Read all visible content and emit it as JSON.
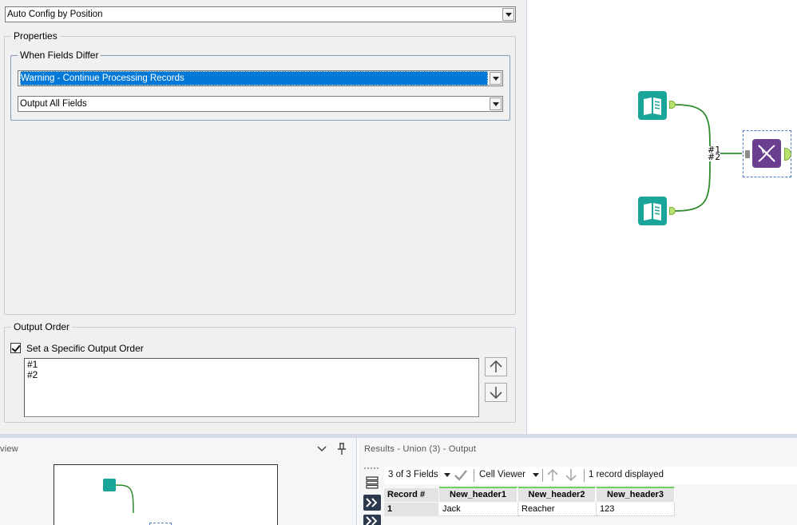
{
  "config": {
    "mode_select": "Auto Config by Position",
    "properties_legend": "Properties",
    "when_fields_differ_legend": "When Fields Differ",
    "action_select": "Warning - Continue Processing Records",
    "output_fields_select": "Output All Fields",
    "output_order_legend": "Output Order",
    "specific_order_label": "Set a Specific Output Order",
    "specific_order_checked": true,
    "order_items": [
      "#1",
      "#2"
    ]
  },
  "canvas": {
    "connection_labels": [
      "#1",
      "#2"
    ],
    "colors": {
      "input_tool": "#1aa59a",
      "union_tool": "#6b3f8f",
      "anchor": "#b5e36b",
      "connector": "#2e8b2e"
    },
    "icons": [
      "book-icon",
      "book-icon",
      "dna-icon"
    ]
  },
  "overview": {
    "title": "view"
  },
  "results": {
    "title": "Results - Union (3) - Output",
    "fields_select": "3 of 3 Fields",
    "cell_viewer": "Cell Viewer",
    "records_status": "1 record displayed",
    "columns": [
      "Record #",
      "New_header1",
      "New_header2",
      "New_header3"
    ],
    "rows": [
      [
        "1",
        "Jack",
        "Reacher",
        "123"
      ]
    ]
  }
}
